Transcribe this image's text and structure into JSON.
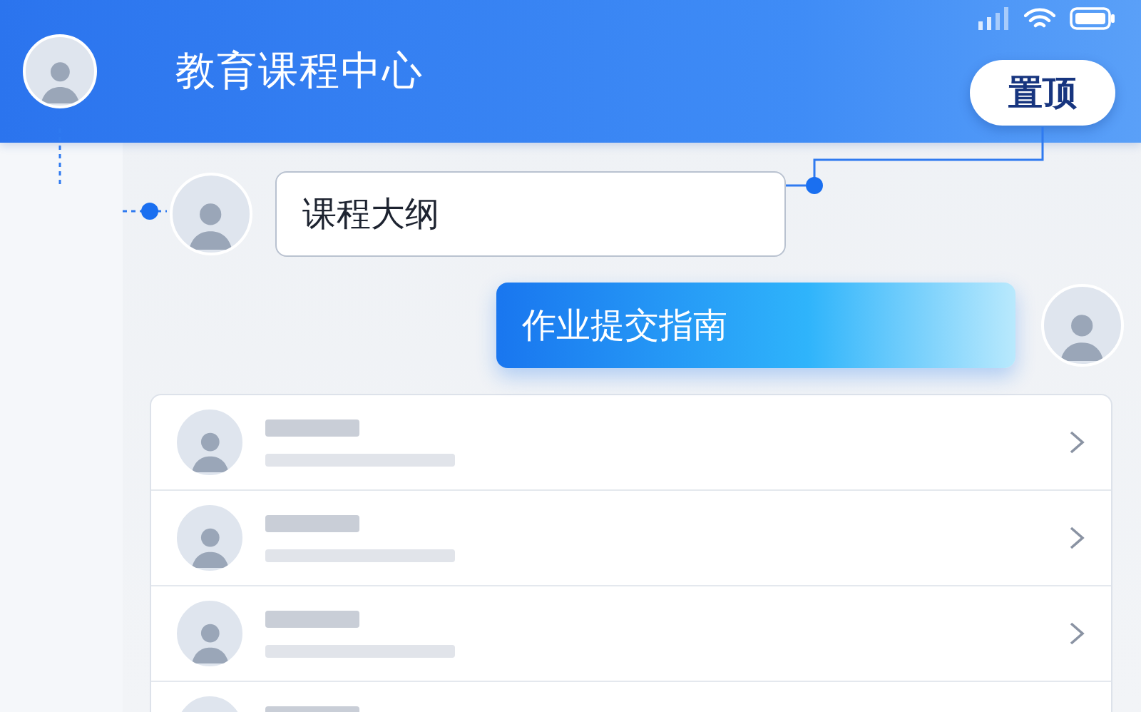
{
  "header": {
    "title": "教育课程中心",
    "pin_button": "置顶"
  },
  "messages": [
    {
      "kind": "received",
      "text": "课程大纲"
    },
    {
      "kind": "sent",
      "text": "作业提交指南"
    }
  ],
  "list": {
    "rows": [
      {
        "kind": "skeleton"
      },
      {
        "kind": "skeleton"
      },
      {
        "kind": "skeleton"
      },
      {
        "kind": "skeleton"
      }
    ]
  }
}
